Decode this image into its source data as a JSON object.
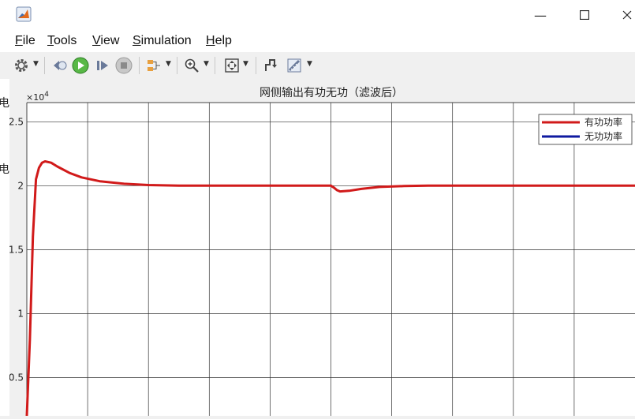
{
  "window": {
    "minimize_glyph": "—",
    "maximize_glyph": "☐"
  },
  "menu": [
    "File",
    "Tools",
    "View",
    "Simulation",
    "Help"
  ],
  "toolbar": {
    "icons": [
      "gear-icon",
      "step-back-icon",
      "run-icon",
      "step-forward-icon",
      "stop-icon",
      "signal-select-icon",
      "zoom-icon",
      "fit-to-view-icon",
      "triggers-icon",
      "measurements-icon"
    ]
  },
  "left_strip": {
    "chars": [
      "电",
      "电"
    ]
  },
  "scope": {
    "background": "#ffffff",
    "grid_color": "#333333"
  },
  "chart_data": {
    "type": "line",
    "title": "网侧输出有功无功（滤波后）",
    "exponent_label": "×10",
    "exponent_power": "4",
    "ylim": [
      0.2,
      2.65
    ],
    "xlim": [
      0,
      10
    ],
    "y_ticks": [
      0.5,
      1,
      1.5,
      2,
      2.5
    ],
    "y_tick_labels": [
      "0.5",
      "1",
      "1.5",
      "2",
      "2.5"
    ],
    "x_gridlines": [
      1,
      2,
      3,
      4,
      5,
      6,
      7,
      8,
      9
    ],
    "legend": {
      "position": "top-right"
    },
    "series": [
      {
        "name": "有功功率",
        "color": "#d11a1a",
        "x": [
          0.0,
          0.05,
          0.1,
          0.15,
          0.2,
          0.25,
          0.3,
          0.4,
          0.5,
          0.7,
          0.9,
          1.2,
          1.6,
          2.0,
          2.5,
          3.0,
          4.0,
          5.0,
          5.05,
          5.1,
          5.15,
          5.3,
          5.5,
          5.8,
          6.2,
          6.6,
          7.0,
          8.0,
          9.0,
          10.0
        ],
        "y": [
          0.2,
          0.8,
          1.6,
          2.05,
          2.14,
          2.18,
          2.19,
          2.18,
          2.15,
          2.1,
          2.065,
          2.035,
          2.015,
          2.005,
          2.001,
          2.0,
          2.0,
          2.0,
          1.985,
          1.965,
          1.955,
          1.96,
          1.975,
          1.99,
          1.997,
          2.0,
          2.0,
          2.0,
          2.0,
          2.0
        ]
      },
      {
        "name": "无功功率",
        "color": "#0f1aa0",
        "x": [],
        "y": []
      }
    ]
  }
}
